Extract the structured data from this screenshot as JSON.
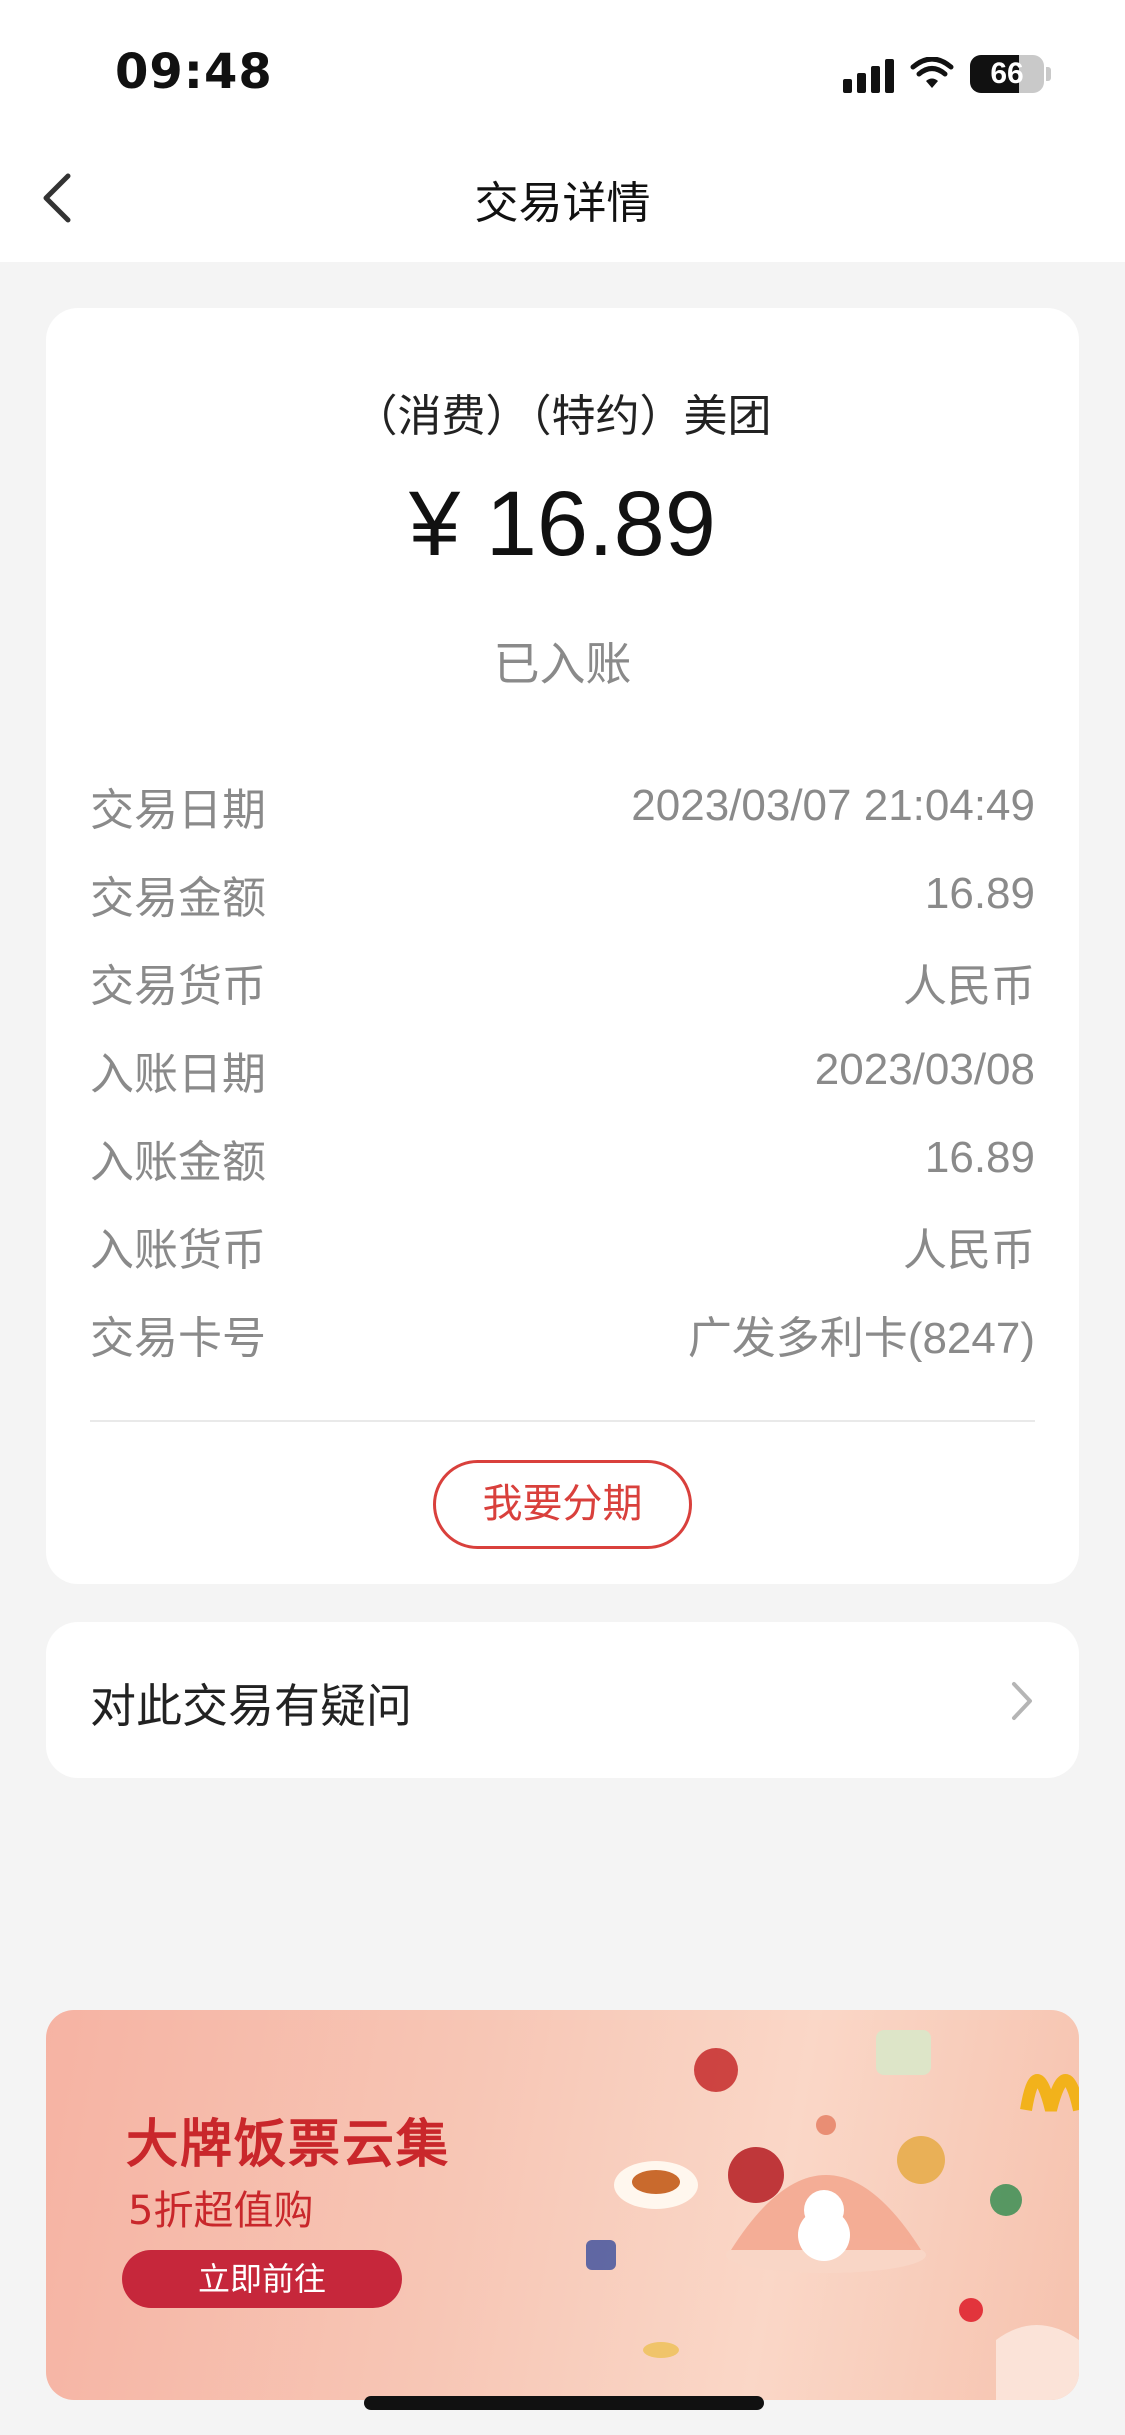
{
  "status_bar": {
    "time": "09:48",
    "battery": "66",
    "battery_level": 0.66
  },
  "nav": {
    "title": "交易详情"
  },
  "transaction": {
    "merchant": "（消费）（特约）美团",
    "amount": "¥ 16.89",
    "status": "已入账",
    "details": [
      {
        "label": "交易日期",
        "value": "2023/03/07 21:04:49"
      },
      {
        "label": "交易金额",
        "value": "16.89"
      },
      {
        "label": "交易货币",
        "value": "人民币"
      },
      {
        "label": "入账日期",
        "value": "2023/03/08"
      },
      {
        "label": "入账金额",
        "value": "16.89"
      },
      {
        "label": "入账货币",
        "value": "人民币"
      },
      {
        "label": "交易卡号",
        "value": "广发多利卡(8247)"
      }
    ],
    "installment_label": "我要分期"
  },
  "question": {
    "label": "对此交易有疑问"
  },
  "banner": {
    "title": "大牌饭票云集",
    "subtitle": "5折超值购",
    "button": "立即前往"
  },
  "colors": {
    "accent": "#d9403c",
    "banner_button": "#c6273b"
  }
}
